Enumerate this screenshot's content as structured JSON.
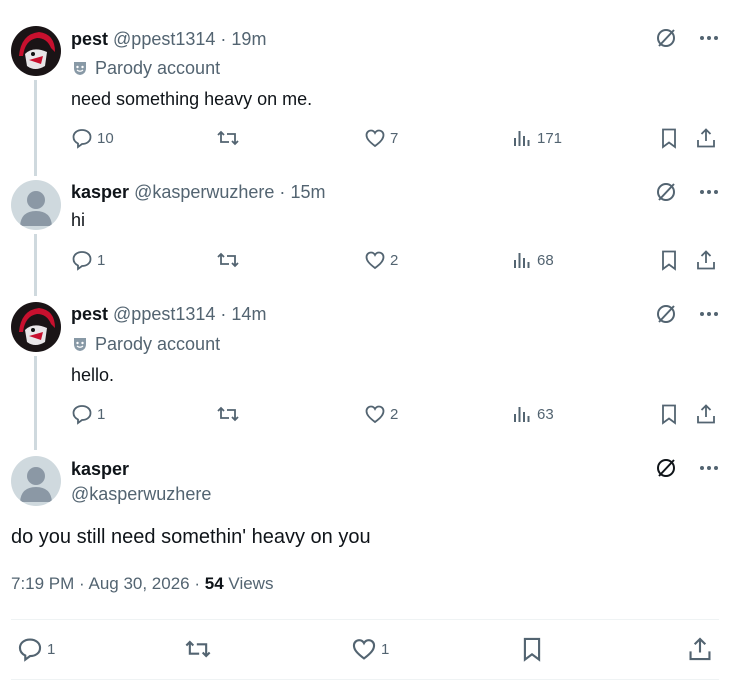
{
  "tweets": [
    {
      "name": "pest",
      "handle": "@ppest1314",
      "dot": "·",
      "time": "19m",
      "parody": "Parody account",
      "text": "need something heavy on me.",
      "replies": "10",
      "likes": "7",
      "views": "171"
    },
    {
      "name": "kasper",
      "handle": "@kasperwuzhere",
      "dot": "·",
      "time": "15m",
      "text": "hi",
      "replies": "1",
      "likes": "2",
      "views": "68"
    },
    {
      "name": "pest",
      "handle": "@ppest1314",
      "dot": "·",
      "time": "14m",
      "parody": "Parody account",
      "text": "hello.",
      "replies": "1",
      "likes": "2",
      "views": "63"
    }
  ],
  "main": {
    "name": "kasper",
    "handle": "@kasperwuzhere",
    "text": "do you still need somethin' heavy on you",
    "timestamp": "7:19 PM · Aug 30, 2026",
    "dot": "·",
    "views_count": "54",
    "views_label": "Views",
    "replies": "1",
    "likes": "1"
  },
  "colors": {
    "muted": "#536471",
    "text": "#0f1419",
    "line": "#cfd9de",
    "avatar_default": "#c4cfd6"
  },
  "icons": [
    "reply-icon",
    "retweet-icon",
    "like-icon",
    "views-icon",
    "bookmark-icon",
    "share-icon",
    "grok-icon",
    "more-icon",
    "parody-mask-icon"
  ]
}
